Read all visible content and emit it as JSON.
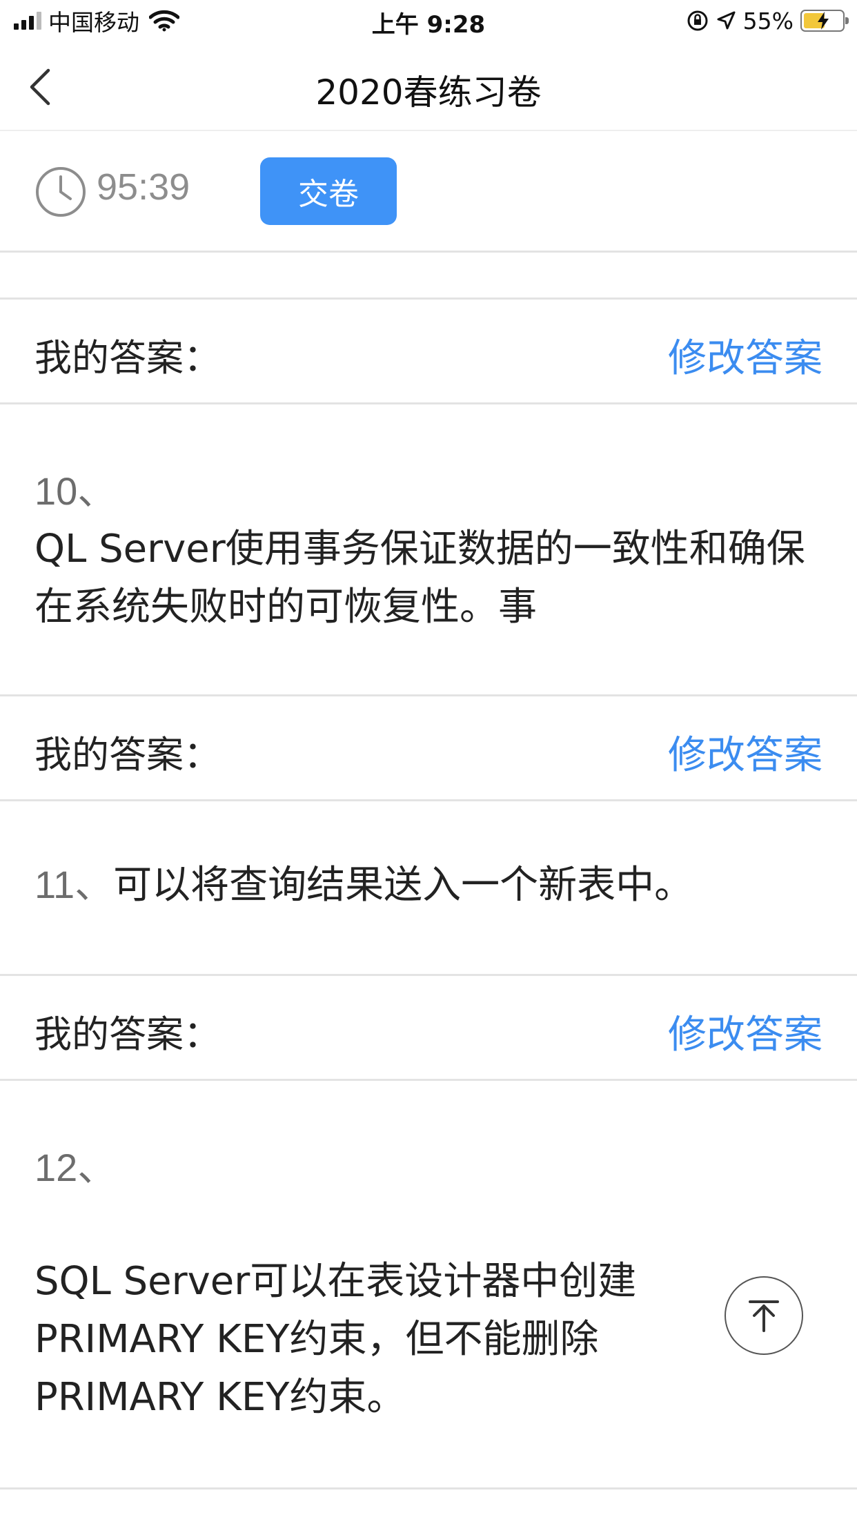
{
  "status_bar": {
    "carrier": "中国移动",
    "time": "上午 9:28",
    "battery_percent": "55%",
    "battery_level": 0.55
  },
  "nav": {
    "title": "2020春练习卷"
  },
  "exam": {
    "timer": "95:39",
    "submit_label": "交卷"
  },
  "answer_label": "我的答案：",
  "modify_label": "修改答案",
  "questions": [
    {
      "number": "10、",
      "text_line1": "QL Server使用事务保证数据的一致性和确保",
      "text_line2": "在系统失败时的可恢复性。事"
    },
    {
      "number": "11、",
      "text": "可以将查询结果送入一个新表中。"
    },
    {
      "number": "12、",
      "text_line1": "SQL Server可以在表设计器中创建",
      "text_line2": "PRIMARY KEY约束，但不能删除",
      "text_line3": "PRIMARY KEY约束。"
    }
  ]
}
